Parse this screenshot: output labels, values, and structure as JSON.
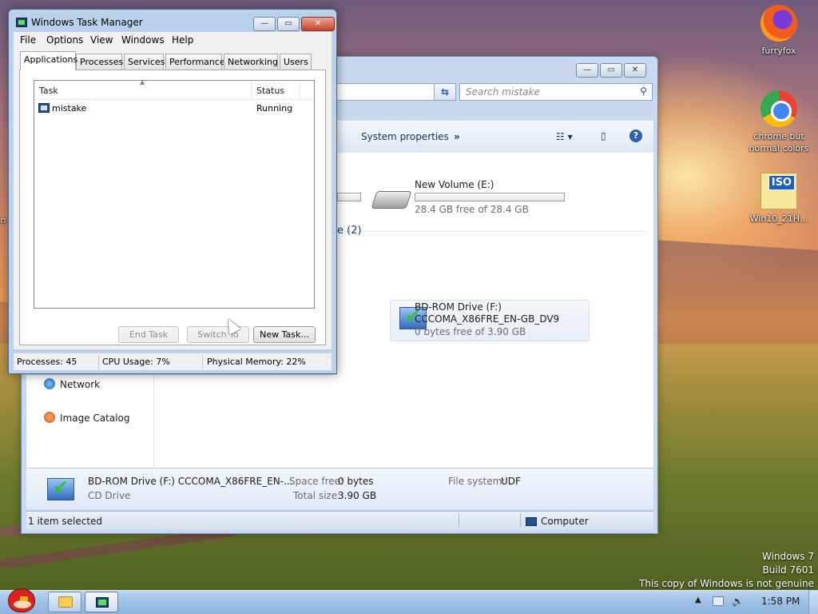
{
  "desktop": {
    "icons": [
      {
        "label": "furryfox",
        "icon": "firefox-icon"
      },
      {
        "label": "chrome but normal colors",
        "icon": "chrome-icon"
      },
      {
        "label": "Win10_21H...",
        "icon": "iso-icon"
      }
    ],
    "watermark": {
      "line1": "Windows 7",
      "line2": "Build 7601",
      "line3": "This copy of Windows is not genuine"
    },
    "partial_left_label": "n"
  },
  "explorer": {
    "search_placeholder": "Search mistake",
    "command_bar": {
      "system_properties": "System properties",
      "more": "»"
    },
    "drives": {
      "e": {
        "name": "New Volume (E:)",
        "free": "28.4 GB free of 28.4 GB",
        "usage": 0
      },
      "f": {
        "name": "BD-ROM Drive (F:)",
        "label": "CCCOMA_X86FRE_EN-GB_DV9",
        "free": "0 bytes free of 3.90 GB"
      }
    },
    "section_partial": "e (2)",
    "nav": {
      "network": "Network",
      "image_catalog": "Image Catalog"
    },
    "details": {
      "name": "BD-ROM Drive (F:) CCCOMA_X86FRE_EN-...",
      "type": "CD Drive",
      "space_free_label": "Space free:",
      "space_free": "0 bytes",
      "total_size_label": "Total size:",
      "total_size": "3.90 GB",
      "file_system_label": "File system:",
      "file_system": "UDF"
    },
    "status": {
      "selected": "1 item selected",
      "location": "Computer"
    }
  },
  "task_manager": {
    "title": "Windows Task Manager",
    "menu": [
      "File",
      "Options",
      "View",
      "Windows",
      "Help"
    ],
    "tabs": [
      "Applications",
      "Processes",
      "Services",
      "Performance",
      "Networking",
      "Users"
    ],
    "columns": {
      "task": "Task",
      "status": "Status"
    },
    "rows": [
      {
        "task": "mistake",
        "status": "Running"
      }
    ],
    "buttons": {
      "end_task": "End Task",
      "switch_to": "Switch To",
      "new_task": "New Task..."
    },
    "status": {
      "processes": "Processes: 45",
      "cpu": "CPU Usage: 7%",
      "memory": "Physical Memory: 22%"
    }
  },
  "taskbar": {
    "clock": "1:58 PM"
  }
}
